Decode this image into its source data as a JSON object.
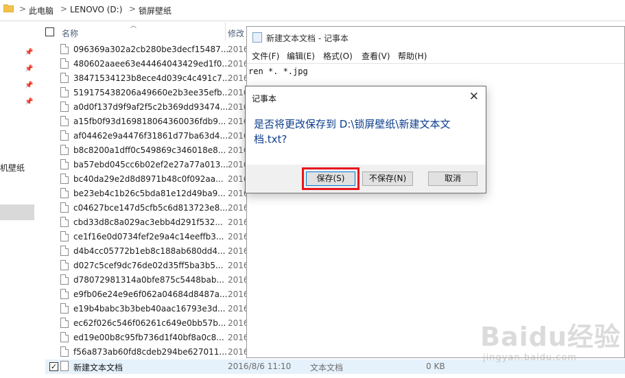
{
  "address_bar": {
    "crumbs": [
      "此电脑",
      "LENOVO (D:)",
      "锁屏壁纸"
    ],
    "separator": ">"
  },
  "nav": {
    "pins": [
      "pin",
      "pin",
      "pin",
      "pin"
    ],
    "visible_label": "机壁纸"
  },
  "file_list": {
    "col_name": "名称",
    "col_modified": "修改",
    "files": [
      {
        "name": "096369a302a2cb280be3decf15487...",
        "date": "2016"
      },
      {
        "name": "480602aaee63e44464043429ed1f0...",
        "date": "2016"
      },
      {
        "name": "38471534123b8ece4d039c4c491c7...",
        "date": "2016"
      },
      {
        "name": "519175438206a49660e2b3ee35efb...",
        "date": "2016"
      },
      {
        "name": "a0d0f137d9f9af2f5c2b369dd93474...",
        "date": "2016"
      },
      {
        "name": "a15fb0f93d169818064360036fdb9...",
        "date": "2016"
      },
      {
        "name": "af04462e9a4476f31861d77ba63d4...",
        "date": "2016"
      },
      {
        "name": "b8c8200a1dff0c549869c346018e8...",
        "date": "2016"
      },
      {
        "name": "ba57ebd045cc6b02ef2e27a77a013...",
        "date": "2016"
      },
      {
        "name": "bc40da29e2d8d8971b48c0f092aa...",
        "date": "2016"
      },
      {
        "name": "be23eb4c1b26c5bda81e12d49ba9...",
        "date": "2016"
      },
      {
        "name": "c04627bce147d5cfb5c6d813723e8...",
        "date": "2016"
      },
      {
        "name": "cbd33d8c8a029ac3ebb4d291f532...",
        "date": "2016"
      },
      {
        "name": "ce1f16e0d0734fef2e9a4c14eeffb3...",
        "date": "2016"
      },
      {
        "name": "d4b4cc05772b1eb8c188ab680dd4...",
        "date": "2016"
      },
      {
        "name": "d027c5cef9dc76de02d35ff5ba3b5...",
        "date": "2016"
      },
      {
        "name": "d78072981314a0bfe875c5448bab...",
        "date": "2016"
      },
      {
        "name": "e9fb06e24e9e6f062a04684d8487a...",
        "date": "2016"
      },
      {
        "name": "e19b4babc3b3beb40aac16793e3d...",
        "date": "2016"
      },
      {
        "name": "ec62f026c546f06261c649e0bb57b...",
        "date": "2016"
      },
      {
        "name": "ed19e00b8c95fb736d1f40bf8a0c8...",
        "date": "2016"
      },
      {
        "name": "f56a873ab60fd8cdeb294be627011...",
        "date": "2016"
      }
    ],
    "selected_file": {
      "name": "新建文本文档",
      "date": "2016/8/6 11:10",
      "type": "文本文档",
      "size": "0 KB",
      "checked": "✓"
    }
  },
  "notepad": {
    "title": "新建文本文档 - 记事本",
    "menu": [
      "文件(F)",
      "编辑(E)",
      "格式(O)",
      "查看(V)",
      "帮助(H)"
    ],
    "content": "ren *. *.jpg"
  },
  "dialog": {
    "title": "记事本",
    "close_glyph": "✕",
    "message": "是否将更改保存到 D:\\锁屏壁纸\\新建文本文档.txt?",
    "buttons": {
      "save": "保存(S)",
      "dont_save": "不保存(N)",
      "cancel": "取消"
    },
    "highlight_color": "#e8141c",
    "message_color": "#0a3c8c"
  },
  "watermark": {
    "brand": "Baidu经验",
    "site": "jingyan.baidu.com"
  }
}
